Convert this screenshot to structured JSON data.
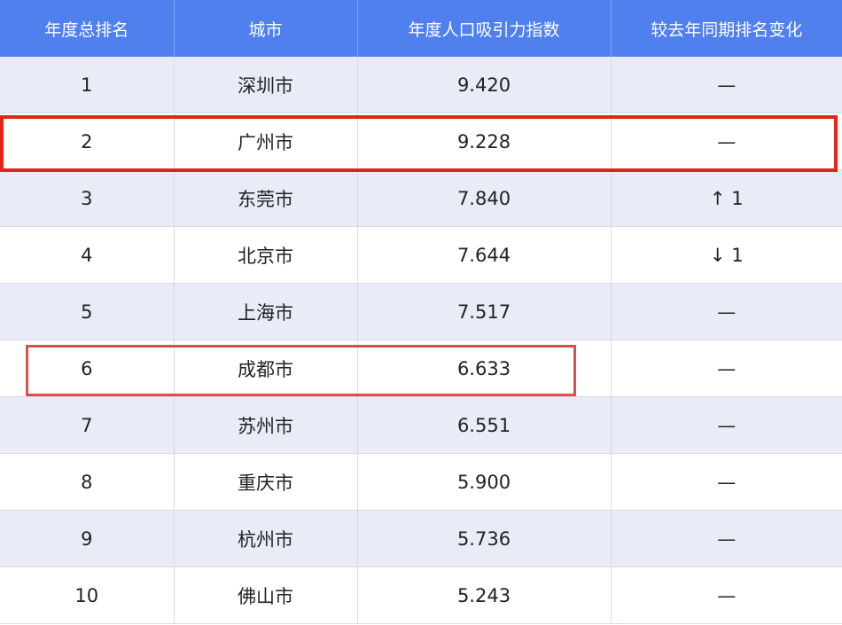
{
  "columns": [
    "年度总排名",
    "城市",
    "年度人口吸引力指数",
    "较去年同期排名变化"
  ],
  "rows": [
    {
      "rank": "1",
      "city": "深圳市",
      "index": "9.420",
      "change": "—",
      "trend": "same"
    },
    {
      "rank": "2",
      "city": "广州市",
      "index": "9.228",
      "change": "—",
      "trend": "same"
    },
    {
      "rank": "3",
      "city": "东莞市",
      "index": "7.840",
      "change": "↑ 1",
      "trend": "up"
    },
    {
      "rank": "4",
      "city": "北京市",
      "index": "7.644",
      "change": "↓ 1",
      "trend": "down"
    },
    {
      "rank": "5",
      "city": "上海市",
      "index": "7.517",
      "change": "—",
      "trend": "same"
    },
    {
      "rank": "6",
      "city": "成都市",
      "index": "6.633",
      "change": "—",
      "trend": "same"
    },
    {
      "rank": "7",
      "city": "苏州市",
      "index": "6.551",
      "change": "—",
      "trend": "same"
    },
    {
      "rank": "8",
      "city": "重庆市",
      "index": "5.900",
      "change": "—",
      "trend": "same"
    },
    {
      "rank": "9",
      "city": "杭州市",
      "index": "5.736",
      "change": "—",
      "trend": "same"
    },
    {
      "rank": "10",
      "city": "佛山市",
      "index": "5.243",
      "change": "—",
      "trend": "same"
    }
  ],
  "colors": {
    "header_bg": "#4f80ee",
    "row_alt_bg": "#e9ecf6",
    "highlight": "#e0261b",
    "up": "#b3461f",
    "down": "#1f8a2c"
  }
}
